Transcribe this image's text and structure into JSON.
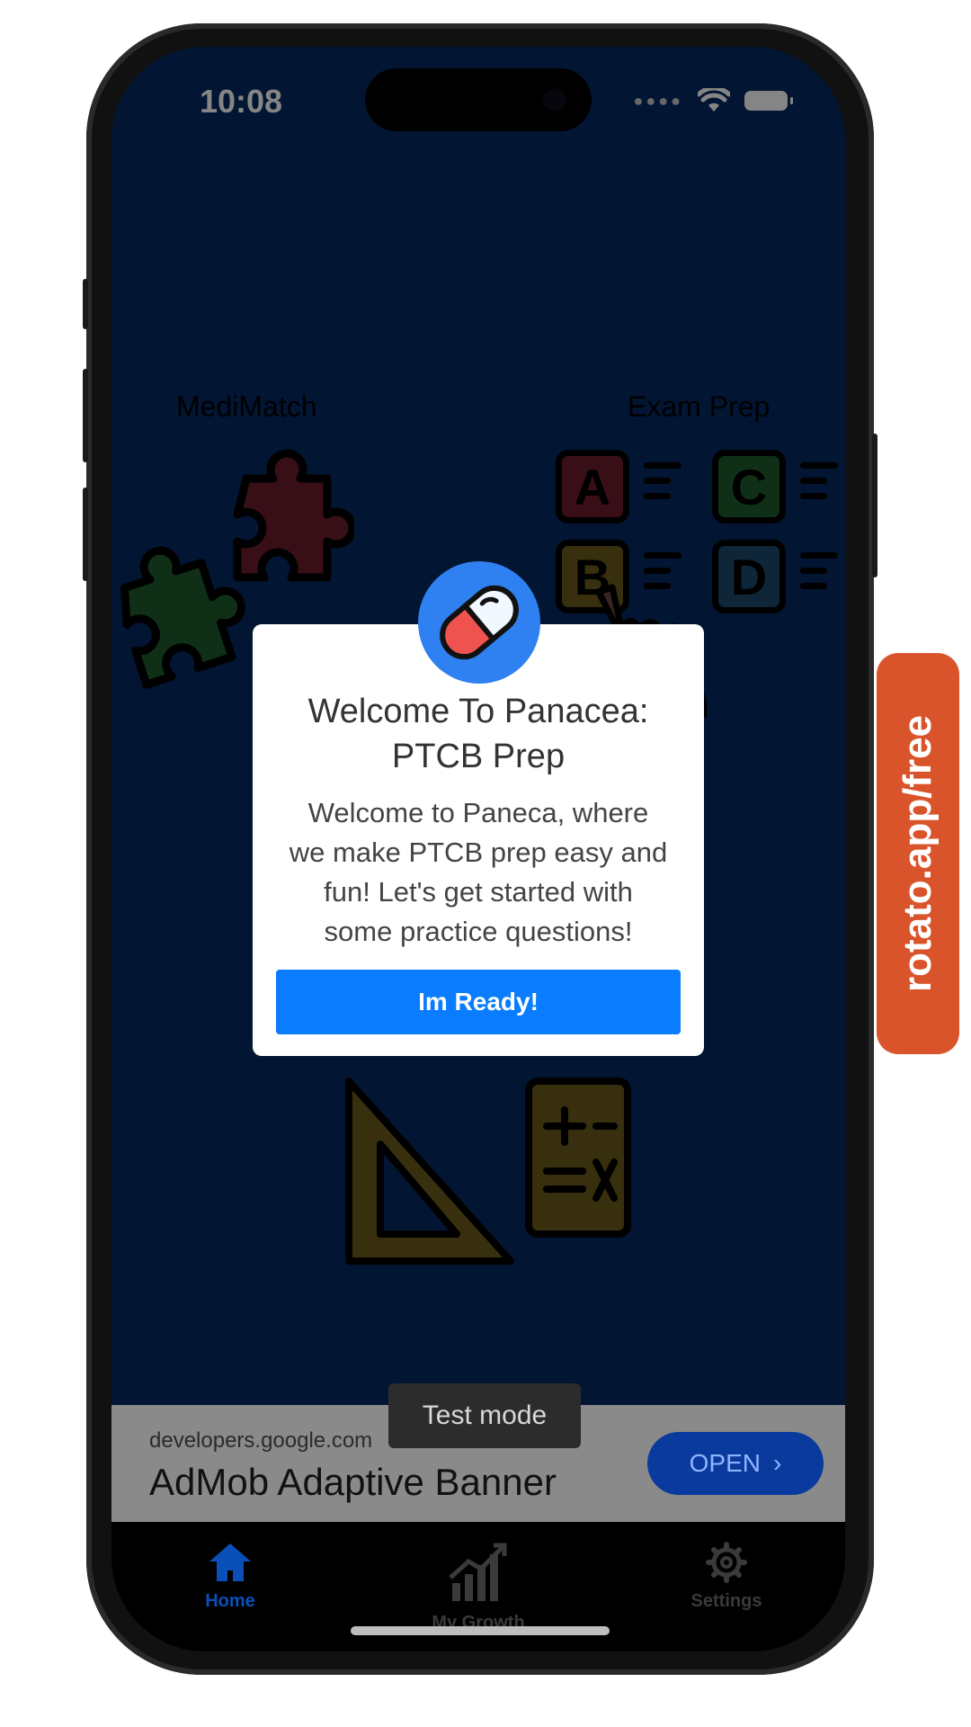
{
  "status_bar": {
    "time": "10:08"
  },
  "background": {
    "left_card_label": "MediMatch",
    "right_card_label": "Exam Prep",
    "answer_letters": [
      "A",
      "C",
      "B",
      "D"
    ]
  },
  "modal": {
    "title_line1": "Welcome To Panacea:",
    "title_line2": "PTCB Prep",
    "body_lines": [
      "Welcome to Paneca, where",
      "we make PTCB prep easy and",
      "fun! Let's get started with",
      "some practice questions!"
    ],
    "button_label": "Im Ready!"
  },
  "ad": {
    "url": "developers.google.com",
    "title": "AdMob Adaptive Banner",
    "open_label": "OPEN",
    "test_mode_label": "Test mode"
  },
  "tabs": [
    {
      "label": "Home",
      "icon": "home-icon",
      "active": true
    },
    {
      "label": "My Growth",
      "icon": "growth-chart-icon",
      "active": false
    },
    {
      "label": "Settings",
      "icon": "gear-icon",
      "active": false
    }
  ],
  "watermark": {
    "text": "rotato.app/free"
  },
  "colors": {
    "screen_bg": "#052a63",
    "primary_button": "#0a7cff",
    "active_tab": "#0a4fb8",
    "inactive_tab": "#3a3a3a",
    "watermark_bg": "#d9542b"
  }
}
